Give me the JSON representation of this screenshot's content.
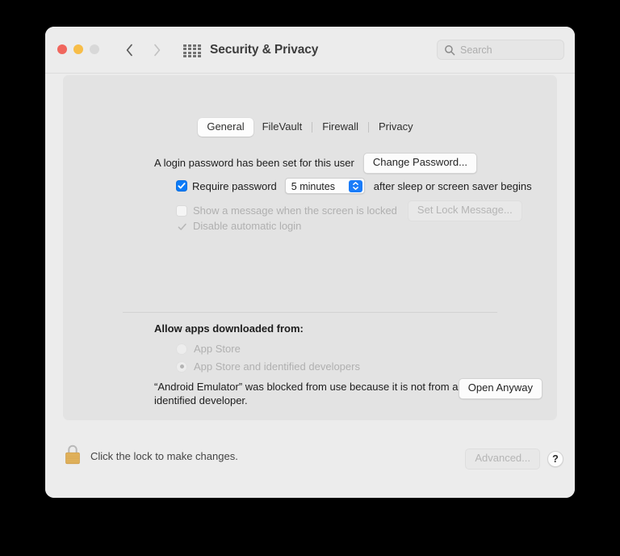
{
  "window": {
    "title": "Security & Privacy",
    "icons": {
      "back": "chevron-left-icon",
      "forward": "chevron-right-icon",
      "grid": "grid-view-icon",
      "search": "search-icon",
      "lock": "lock-closed-icon"
    },
    "traffic_lights": {
      "close_color": "#f0665d",
      "minimize_color": "#f7bd48",
      "zoom_color": "#d8d8d8"
    }
  },
  "search": {
    "value": "",
    "placeholder": "Search"
  },
  "tabs": [
    {
      "label": "General",
      "active": true
    },
    {
      "label": "FileVault",
      "active": false
    },
    {
      "label": "Firewall",
      "active": false
    },
    {
      "label": "Privacy",
      "active": false
    }
  ],
  "general": {
    "login_password_text": "A login password has been set for this user",
    "change_password_label": "Change Password...",
    "require_password": {
      "label": "Require password",
      "checked": true,
      "delay_value": "5 minutes",
      "suffix": "after sleep or screen saver begins"
    },
    "show_message": {
      "label": "Show a message when the screen is locked",
      "checked": false,
      "enabled": false,
      "button_label": "Set Lock Message..."
    },
    "disable_auto_login": {
      "label": "Disable automatic login",
      "checked": true,
      "enabled": false
    }
  },
  "gatekeeper": {
    "heading": "Allow apps downloaded from:",
    "options": [
      {
        "label": "App Store",
        "selected": false,
        "enabled": false
      },
      {
        "label": "App Store and identified developers",
        "selected": true,
        "enabled": false
      }
    ],
    "blocked_message": "“Android Emulator” was blocked from use because it is not from an identified developer.",
    "open_anyway_label": "Open Anyway"
  },
  "footer": {
    "lock_text": "Click the lock to make changes.",
    "advanced_label": "Advanced...",
    "advanced_enabled": false,
    "help_label": "?"
  },
  "colors": {
    "accent_blue": "#0b7bf8",
    "window_bg": "#ececec",
    "panel_bg": "#e3e3e3",
    "lock_body": "#e3b35c"
  }
}
